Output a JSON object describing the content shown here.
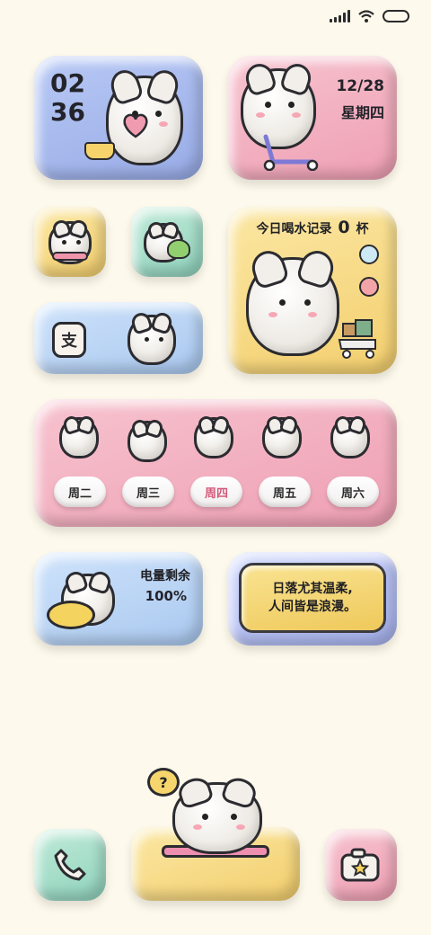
{
  "clock": {
    "hour": "02",
    "minute": "36"
  },
  "date": {
    "day": "12/28",
    "weekday": "星期四"
  },
  "water": {
    "label": "今日喝水记录",
    "count": "0",
    "unit": "杯"
  },
  "alipay": {
    "label": "支"
  },
  "week": {
    "days": [
      "周二",
      "周三",
      "周四",
      "周五",
      "周六"
    ],
    "active_index": 2
  },
  "battery": {
    "label": "电量剩余",
    "value": "100%"
  },
  "quote": {
    "line1": "日落尤其温柔,",
    "line2": "人间皆是浪漫。"
  },
  "dock": {
    "question": "?"
  },
  "colors": {
    "background": "#fdf9ec",
    "blue": "#a9b9ee",
    "pink": "#f1aebf",
    "yellow": "#f6d982",
    "mint": "#a6dcc8",
    "active_day": "#d35a7a"
  },
  "icons": [
    "signal-icon",
    "wifi-icon",
    "battery-icon",
    "heart-icon",
    "scooter-icon",
    "phone-icon",
    "camera-icon",
    "star-icon",
    "question-icon"
  ]
}
